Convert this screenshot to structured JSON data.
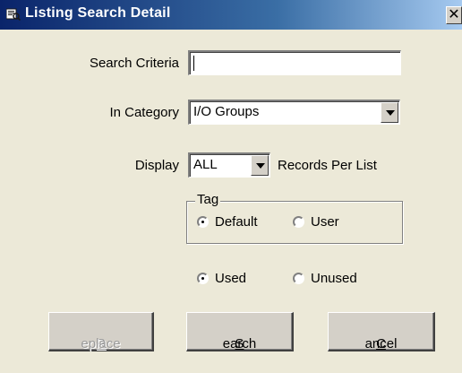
{
  "window": {
    "title": "Listing Search Detail",
    "close": "✕"
  },
  "search_criteria": {
    "label": "Search Criteria",
    "value": ""
  },
  "in_category": {
    "label": "In Category",
    "value": "I/O Groups"
  },
  "display": {
    "label": "Display",
    "value": "ALL",
    "suffix": "Records Per List"
  },
  "tag": {
    "legend": "Tag",
    "default_label": "Default",
    "user_label": "User",
    "selected": "Default"
  },
  "usage": {
    "used_label": "Used",
    "unused_label": "Unused",
    "selected": "Used"
  },
  "buttons": {
    "replace": {
      "mnemonic": "R",
      "rest": "eplace",
      "enabled": false
    },
    "search": {
      "mnemonic": "S",
      "rest": "earch",
      "enabled": true
    },
    "cancel": {
      "mnemonic": "C",
      "rest": "ancel",
      "enabled": true
    }
  },
  "colors": {
    "titlebar_start": "#0a246a",
    "titlebar_end": "#a6caf0",
    "dialog_bg": "#ece9d8"
  }
}
